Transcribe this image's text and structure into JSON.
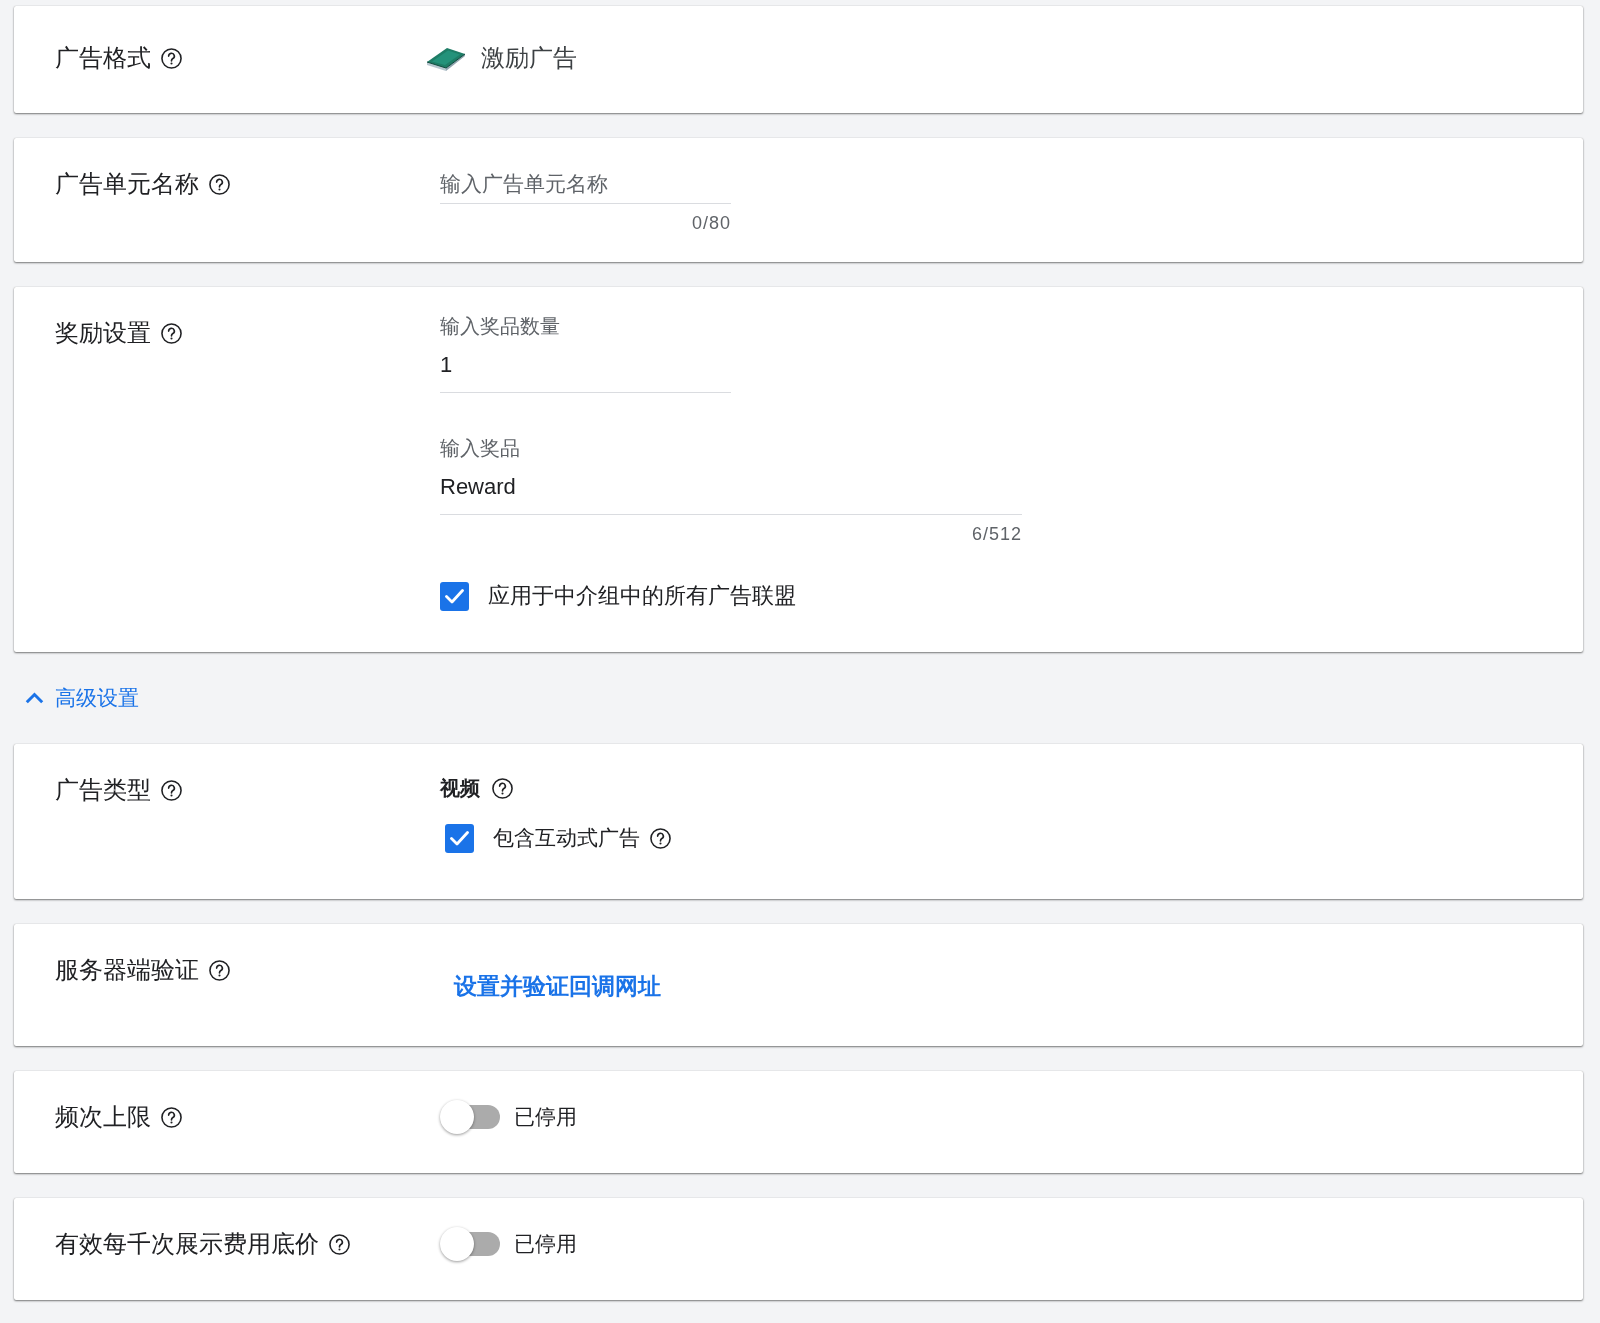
{
  "sections": [
    {
      "kind": "format",
      "label": "广告格式",
      "help": true,
      "format": {
        "name": "激励广告"
      }
    },
    {
      "kind": "name",
      "label": "广告单元名称",
      "help": true,
      "field": {
        "placeholder": "输入广告单元名称",
        "counter": "0/80"
      }
    },
    {
      "kind": "reward",
      "label": "奖励设置",
      "help": true,
      "fields": [
        {
          "kind": "number",
          "label": "输入奖品数量",
          "value": "1"
        },
        {
          "kind": "text",
          "label": "输入奖品",
          "value": "Reward",
          "counter": "6/512"
        }
      ],
      "checkbox": {
        "label": "应用于中介组中的所有广告联盟",
        "checked": true
      }
    }
  ],
  "advanced": {
    "label": "高级设置",
    "expanded": true,
    "sections": [
      {
        "kind": "ad_type",
        "label": "广告类型",
        "help": true,
        "option": {
          "label": "视频",
          "help": true
        },
        "checkbox": {
          "label": "包含互动式广告",
          "checked": true,
          "help": true
        }
      },
      {
        "kind": "link",
        "label": "服务器端验证",
        "help": true,
        "link": "设置并验证回调网址"
      },
      {
        "kind": "switch",
        "label": "频次上限",
        "help": true,
        "switch": {
          "on": false,
          "status": "已停用"
        }
      },
      {
        "kind": "switch",
        "label": "有效每千次展示费用底价",
        "help": true,
        "switch": {
          "on": false,
          "status": "已停用"
        }
      }
    ]
  }
}
